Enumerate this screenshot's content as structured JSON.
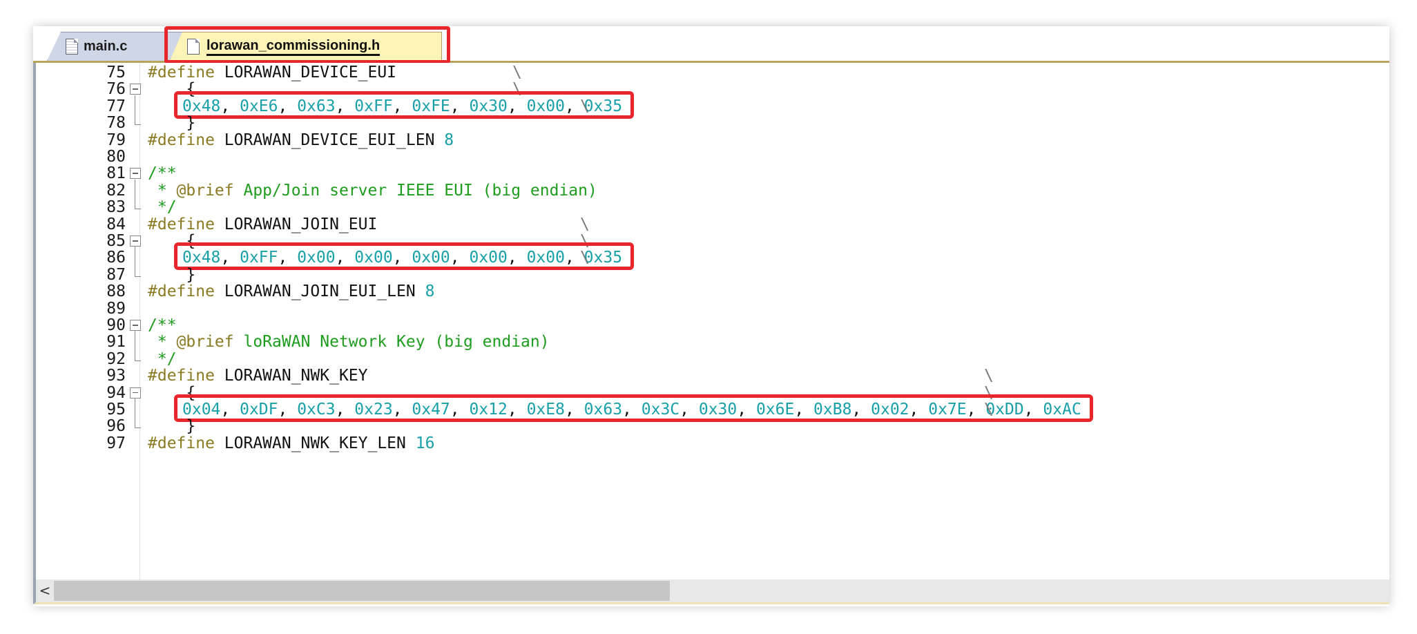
{
  "tabs": [
    {
      "label": "main.c",
      "active": false
    },
    {
      "label": "lorawan_commissioning.h",
      "active": true
    }
  ],
  "highlight_color": "#e8262c",
  "lines": [
    {
      "n": "75",
      "fold": "none",
      "code": [
        {
          "c": "pp",
          "t": "#define"
        },
        {
          "c": "id",
          "t": " LORAWAN_DEVICE_EUI"
        }
      ],
      "bs": 1
    },
    {
      "n": "76",
      "fold": "open",
      "code": [
        {
          "c": "id",
          "t": "    {"
        }
      ],
      "bs": 1
    },
    {
      "n": "77",
      "fold": "mid",
      "hex": [
        "0x48",
        "0xE6",
        "0x63",
        "0xFF",
        "0xFE",
        "0x30",
        "0x00",
        "0x35"
      ],
      "bs": 2
    },
    {
      "n": "78",
      "fold": "end",
      "code": [
        {
          "c": "id",
          "t": "    }"
        }
      ]
    },
    {
      "n": "79",
      "fold": "none",
      "code": [
        {
          "c": "pp",
          "t": "#define"
        },
        {
          "c": "id",
          "t": " LORAWAN_DEVICE_EUI_LEN "
        },
        {
          "c": "num",
          "t": "8"
        }
      ]
    },
    {
      "n": "80",
      "fold": "none",
      "code": []
    },
    {
      "n": "81",
      "fold": "open",
      "code": [
        {
          "c": "cm",
          "t": "/**"
        }
      ]
    },
    {
      "n": "82",
      "fold": "mid",
      "code": [
        {
          "c": "cm",
          "t": " * "
        },
        {
          "c": "pp",
          "t": "@brief"
        },
        {
          "c": "cm",
          "t": " App/Join server IEEE EUI (big endian)"
        }
      ]
    },
    {
      "n": "83",
      "fold": "end",
      "code": [
        {
          "c": "cm",
          "t": " */"
        }
      ]
    },
    {
      "n": "84",
      "fold": "none",
      "code": [
        {
          "c": "pp",
          "t": "#define"
        },
        {
          "c": "id",
          "t": " LORAWAN_JOIN_EUI"
        }
      ],
      "bs": 3
    },
    {
      "n": "85",
      "fold": "open",
      "code": [
        {
          "c": "id",
          "t": "    {"
        }
      ],
      "bs": 3
    },
    {
      "n": "86",
      "fold": "mid",
      "hex": [
        "0x48",
        "0xFF",
        "0x00",
        "0x00",
        "0x00",
        "0x00",
        "0x00",
        "0x35"
      ],
      "bs": 2
    },
    {
      "n": "87",
      "fold": "end",
      "code": [
        {
          "c": "id",
          "t": "    }"
        }
      ]
    },
    {
      "n": "88",
      "fold": "none",
      "code": [
        {
          "c": "pp",
          "t": "#define"
        },
        {
          "c": "id",
          "t": " LORAWAN_JOIN_EUI_LEN "
        },
        {
          "c": "num",
          "t": "8"
        }
      ]
    },
    {
      "n": "89",
      "fold": "none",
      "code": []
    },
    {
      "n": "90",
      "fold": "open",
      "code": [
        {
          "c": "cm",
          "t": "/**"
        }
      ]
    },
    {
      "n": "91",
      "fold": "mid",
      "code": [
        {
          "c": "cm",
          "t": " * "
        },
        {
          "c": "pp",
          "t": "@brief"
        },
        {
          "c": "cm",
          "t": " loRaWAN Network Key (big endian)"
        }
      ]
    },
    {
      "n": "92",
      "fold": "end",
      "code": [
        {
          "c": "cm",
          "t": " */"
        }
      ]
    },
    {
      "n": "93",
      "fold": "none",
      "code": [
        {
          "c": "pp",
          "t": "#define"
        },
        {
          "c": "id",
          "t": " LORAWAN_NWK_KEY"
        }
      ],
      "bs": 4
    },
    {
      "n": "94",
      "fold": "open",
      "code": [
        {
          "c": "id",
          "t": "    {"
        }
      ],
      "bs": 4
    },
    {
      "n": "95",
      "fold": "mid",
      "hex": [
        "0x04",
        "0xDF",
        "0xC3",
        "0x23",
        "0x47",
        "0x12",
        "0xE8",
        "0x63",
        "0x3C",
        "0x30",
        "0x6E",
        "0xB8",
        "0x02",
        "0x7E",
        "0xDD",
        "0xAC"
      ],
      "bs": 5
    },
    {
      "n": "96",
      "fold": "end",
      "code": [
        {
          "c": "id",
          "t": "    }"
        }
      ]
    },
    {
      "n": "97",
      "fold": "none",
      "code": [
        {
          "c": "pp",
          "t": "#define"
        },
        {
          "c": "id",
          "t": " LORAWAN_NWK_KEY_LEN "
        },
        {
          "c": "num",
          "t": "16"
        }
      ]
    }
  ],
  "backslash": "\\",
  "scrollbar": {
    "left_arrow": "<"
  }
}
